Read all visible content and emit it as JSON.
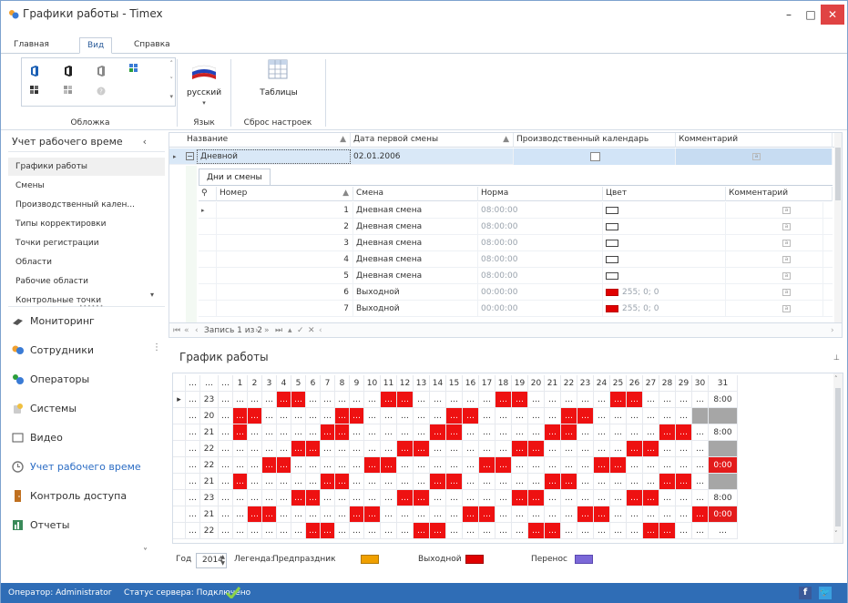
{
  "window": {
    "title": "Графики работы - Timex",
    "minimize": "–",
    "maximize": "□",
    "close": "✕"
  },
  "tabs": [
    "Главная",
    "Вид",
    "Справка"
  ],
  "ribbon": {
    "skin_group": "Обложка",
    "lang_button": "русский",
    "lang_group": "Язык",
    "tables_button": "Таблицы",
    "reset_group": "Сброс настроек"
  },
  "sidebar": {
    "header": "Учет рабочего време",
    "items": [
      "Графики работы",
      "Смены",
      "Производственный кален...",
      "Типы корректировки",
      "Точки регистрации",
      "Области",
      "Рабочие области",
      "Контрольные точки"
    ],
    "nav": [
      "Мониторинг",
      "Сотрудники",
      "Операторы",
      "Системы",
      "Видео",
      "Учет рабочего време",
      "Контроль доступа",
      "Отчеты"
    ]
  },
  "schedules": {
    "columns": [
      "Название",
      "Дата первой смены",
      "Производственный календарь",
      "Комментарий"
    ],
    "row": {
      "name": "Дневной",
      "date": "02.01.2006"
    },
    "detail_tab": "Дни и смены",
    "detail_columns": [
      "Номер",
      "Смена",
      "Норма",
      "Цвет",
      "Комментарий"
    ],
    "detail_rows": [
      {
        "num": "1",
        "shift": "Дневная смена",
        "norm": "08:00:00",
        "color": "",
        "red": false
      },
      {
        "num": "2",
        "shift": "Дневная смена",
        "norm": "08:00:00",
        "color": "",
        "red": false
      },
      {
        "num": "3",
        "shift": "Дневная смена",
        "norm": "08:00:00",
        "color": "",
        "red": false
      },
      {
        "num": "4",
        "shift": "Дневная смена",
        "norm": "08:00:00",
        "color": "",
        "red": false
      },
      {
        "num": "5",
        "shift": "Дневная смена",
        "norm": "08:00:00",
        "color": "",
        "red": false
      },
      {
        "num": "6",
        "shift": "Выходной",
        "norm": "00:00:00",
        "color": "255; 0; 0",
        "red": true
      },
      {
        "num": "7",
        "shift": "Выходной",
        "norm": "00:00:00",
        "color": "255; 0; 0",
        "red": true
      }
    ],
    "pager": "Запись 1 из 2"
  },
  "calendar": {
    "title": "График работы",
    "days": [
      "1",
      "2",
      "3",
      "4",
      "5",
      "6",
      "7",
      "8",
      "9",
      "10",
      "11",
      "12",
      "13",
      "14",
      "15",
      "16",
      "17",
      "18",
      "19",
      "20",
      "21",
      "22",
      "23",
      "24",
      "25",
      "26",
      "27",
      "28",
      "29",
      "30",
      "31"
    ],
    "rows": [
      {
        "n": "23",
        "red": [
          4,
          5,
          11,
          12,
          18,
          19,
          25,
          26
        ],
        "last": "8:00",
        "lastType": ""
      },
      {
        "n": "20",
        "red": [
          1,
          2,
          8,
          9,
          15,
          16,
          22,
          23
        ],
        "last": "",
        "lastType": "g",
        "gray30": true
      },
      {
        "n": "21",
        "red": [
          1,
          7,
          8,
          14,
          15,
          21,
          22,
          28,
          29
        ],
        "last": "8:00",
        "lastType": ""
      },
      {
        "n": "22",
        "red": [
          5,
          6,
          12,
          13,
          19,
          20,
          26,
          27
        ],
        "last": "",
        "lastType": "g"
      },
      {
        "n": "22",
        "red": [
          3,
          4,
          10,
          11,
          17,
          18,
          24,
          25
        ],
        "last": "0:00",
        "lastType": "r"
      },
      {
        "n": "21",
        "red": [
          1,
          7,
          8,
          14,
          15,
          21,
          22,
          28,
          29
        ],
        "last": "",
        "lastType": "g"
      },
      {
        "n": "23",
        "red": [
          5,
          6,
          12,
          13,
          19,
          20,
          26,
          27
        ],
        "last": "8:00",
        "lastType": ""
      },
      {
        "n": "21",
        "red": [
          2,
          3,
          9,
          10,
          16,
          17,
          23,
          24,
          30
        ],
        "last": "0:00",
        "lastType": "r"
      },
      {
        "n": "22",
        "red": [
          6,
          7,
          13,
          14,
          20,
          21,
          27,
          28
        ],
        "last": "",
        "lastType": ""
      }
    ],
    "year_label": "Год",
    "year": "2014",
    "legend_label": "Легенда:",
    "legend": [
      {
        "label": "Предпраздник",
        "color": "#f0a000"
      },
      {
        "label": "Выходной",
        "color": "#e00000"
      },
      {
        "label": "Перенос",
        "color": "#7b68d8"
      }
    ]
  },
  "status": {
    "operator": "Оператор: Administrator",
    "server": "Статус сервера: Подключено"
  }
}
